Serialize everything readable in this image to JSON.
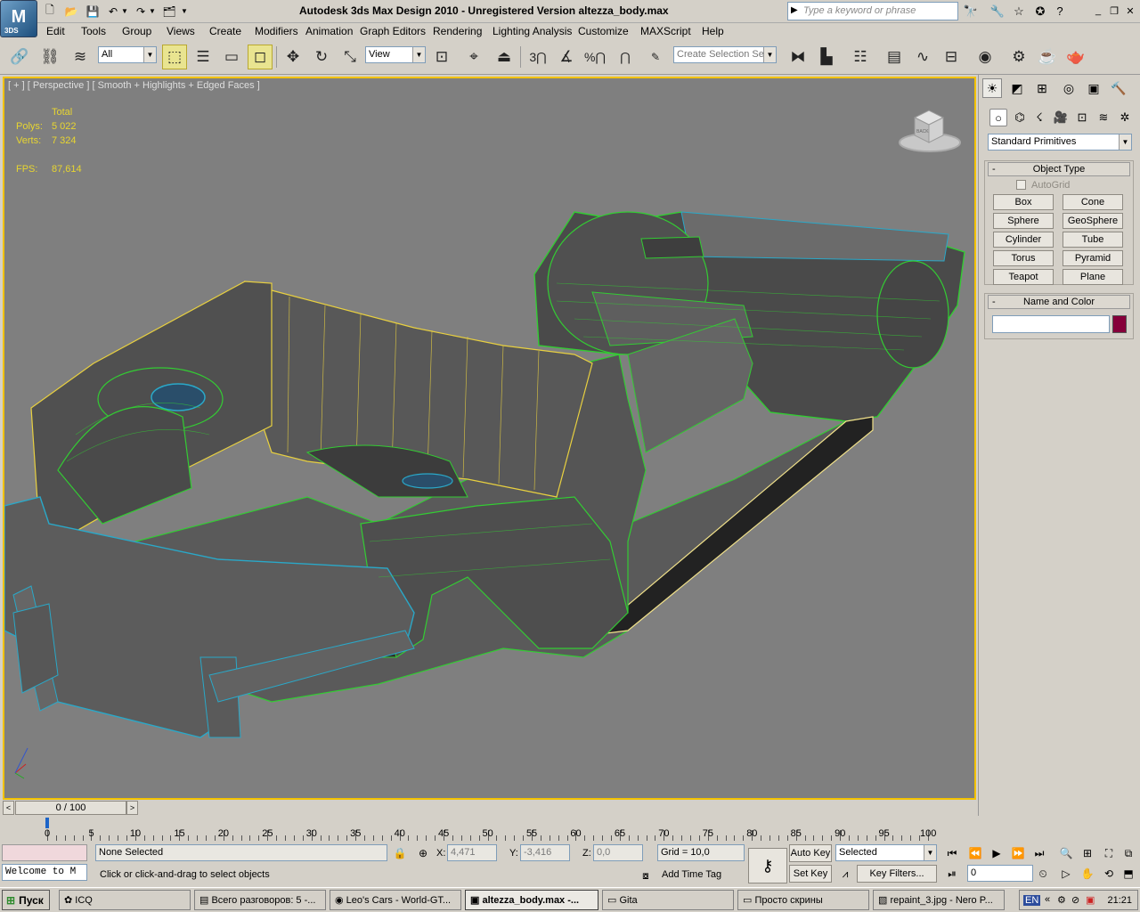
{
  "app": {
    "logo_text": "M",
    "logo_sub": "3DS",
    "title": "Autodesk 3ds Max Design 2010  -  Unregistered Version     altezza_body.max"
  },
  "search": {
    "placeholder": "Type a keyword or phrase"
  },
  "menu": [
    "Edit",
    "Tools",
    "Group",
    "Views",
    "Create",
    "Modifiers",
    "Animation",
    "Graph Editors",
    "Rendering",
    "Lighting Analysis",
    "Customize",
    "MAXScript",
    "Help"
  ],
  "toolbar": {
    "selection_filter": "All",
    "ref_coord": "View",
    "named_selection_placeholder": "Create Selection Se",
    "snap_3": "3",
    "snap_percent": "%",
    "snap_n": "n"
  },
  "viewport": {
    "label": "[ + ] [ Perspective ] [ Smooth + Highlights + Edged Faces ]",
    "stats": {
      "total_label": "Total",
      "polys_label": "Polys:",
      "polys_value": "5 022",
      "verts_label": "Verts:",
      "verts_value": "7 324",
      "fps_label": "FPS:",
      "fps_value": "87,614"
    },
    "cube_text": "BACK"
  },
  "command_panel": {
    "category": "Standard Primitives",
    "object_type_title": "Object Type",
    "autogrid_label": "AutoGrid",
    "primitives": [
      "Box",
      "Cone",
      "Sphere",
      "GeoSphere",
      "Cylinder",
      "Tube",
      "Torus",
      "Pyramid",
      "Teapot",
      "Plane"
    ],
    "name_color_title": "Name and Color",
    "name_value": "",
    "color": "#86003a"
  },
  "timeslider": {
    "label": "0 / 100",
    "prev": "<",
    "next": ">"
  },
  "trackbar": {
    "ticks": [
      "0",
      "5",
      "10",
      "15",
      "20",
      "25",
      "30",
      "35",
      "40",
      "45",
      "50",
      "55",
      "60",
      "65",
      "70",
      "75",
      "80",
      "85",
      "90",
      "95",
      "100"
    ]
  },
  "status": {
    "listener_text": "Welcome to M",
    "selection": "None Selected",
    "prompt": "Click or click-and-drag to select objects",
    "x_label": "X:",
    "x_value": "4,471",
    "y_label": "Y:",
    "y_value": "-3,416",
    "z_label": "Z:",
    "z_value": "0,0",
    "grid": "Grid = 10,0",
    "add_time_tag": "Add Time Tag",
    "auto_key": "Auto Key",
    "set_key": "Set Key",
    "key_mode": "Selected",
    "key_filters": "Key Filters...",
    "frame": "0"
  },
  "taskbar": {
    "start": "Пуск",
    "tasks": [
      "ICQ",
      "Всего разговоров: 5 -...",
      "Leo's Cars - World-GT...",
      "altezza_body.max -...",
      "Gita",
      "Просто скрины",
      "repaint_3.jpg - Nero P..."
    ],
    "lang": "EN",
    "clock": "21:21"
  }
}
